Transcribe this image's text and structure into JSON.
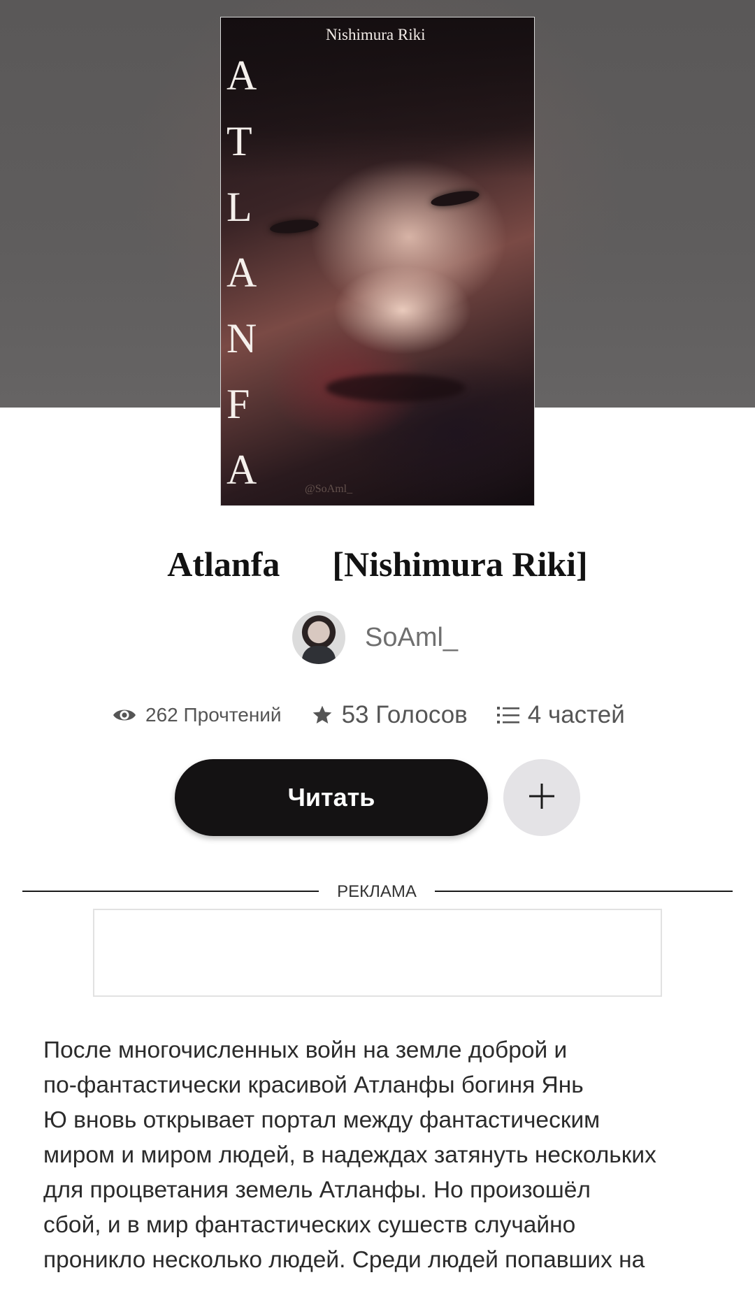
{
  "cover": {
    "author_text": "Nishimura Riki",
    "title_letters": [
      "A",
      "T",
      "L",
      "A",
      "N",
      "F",
      "A"
    ],
    "signature": "@SoAml_"
  },
  "story": {
    "title": "Atlanfa      [Nishimura Riki]"
  },
  "author": {
    "name": "SoAml_",
    "avatar_icon": "user-avatar"
  },
  "stats": {
    "reads": "262 Прочтений",
    "votes": "53 Голосов",
    "parts": "4 частей",
    "icons": [
      "eye-icon",
      "star-icon",
      "list-icon"
    ]
  },
  "actions": {
    "read_label": "Читать",
    "add_icon": "plus-icon"
  },
  "ad": {
    "label": "РЕКЛАМА"
  },
  "description": {
    "lines": [
      "После многочисленных войн на земле доброй и",
      "по-фантастически красивой Атланфы богиня Янь",
      "Ю вновь открывает портал между фантастическим",
      "миром и миром людей, в надеждах затянуть нескольких",
      "для процветания земель Атланфы. Но произошёл",
      "сбой, и в мир фантастических сушеств случайно",
      "проникло несколько людей. Среди людей попавших на"
    ]
  },
  "colors": {
    "hero_background": "#5f5d5d",
    "read_button": "#141213",
    "add_button": "#e4e3e6",
    "muted_text": "#6f6f6f"
  }
}
